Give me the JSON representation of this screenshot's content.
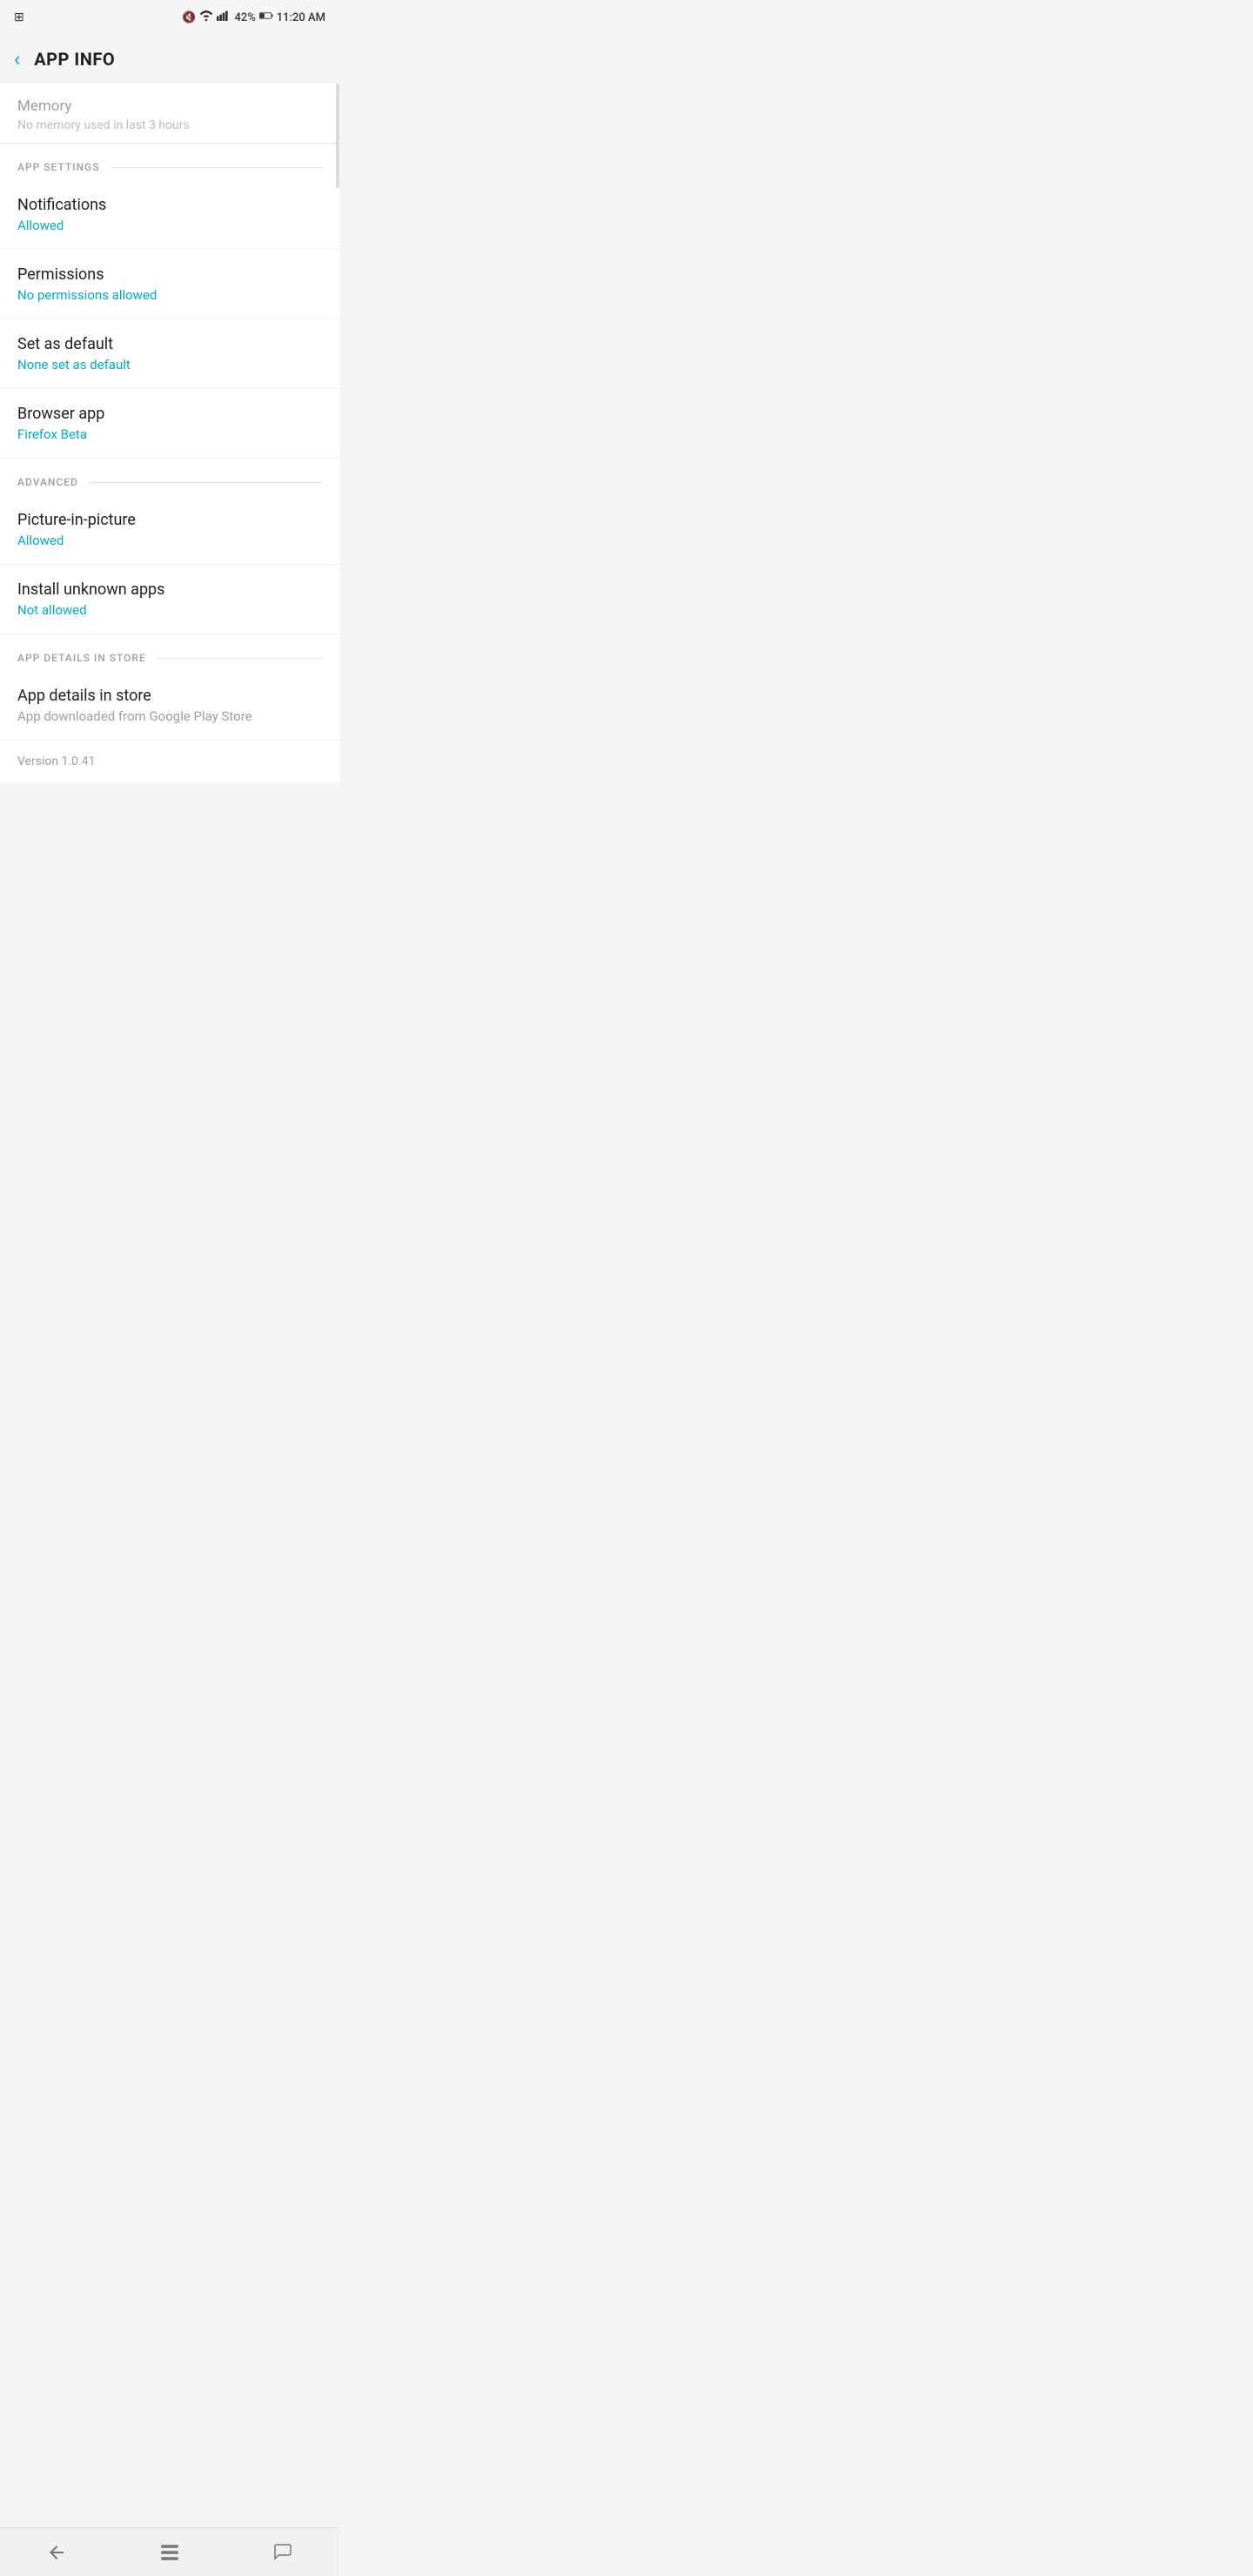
{
  "statusBar": {
    "time": "11:20 AM",
    "battery": "42%",
    "signalBars": "▋▋▋▋",
    "wifiIcon": "wifi",
    "muteIcon": "mute"
  },
  "header": {
    "backLabel": "‹",
    "title": "APP INFO"
  },
  "memory": {
    "title": "Memory",
    "subtitle": "No memory used in last 3 hours"
  },
  "sections": {
    "appSettings": {
      "label": "APP SETTINGS"
    },
    "advanced": {
      "label": "ADVANCED"
    },
    "appDetailsInStore": {
      "label": "APP DETAILS IN STORE"
    }
  },
  "items": {
    "notifications": {
      "title": "Notifications",
      "subtitle": "Allowed"
    },
    "permissions": {
      "title": "Permissions",
      "subtitle": "No permissions allowed"
    },
    "setAsDefault": {
      "title": "Set as default",
      "subtitle": "None set as default"
    },
    "browserApp": {
      "title": "Browser app",
      "subtitle": "Firefox Beta"
    },
    "pictureInPicture": {
      "title": "Picture-in-picture",
      "subtitle": "Allowed"
    },
    "installUnknownApps": {
      "title": "Install unknown apps",
      "subtitle": "Not allowed"
    },
    "appDetailsInStore": {
      "title": "App details in store",
      "subtitle": "App downloaded from Google Play Store"
    }
  },
  "version": {
    "text": "Version 1.0.41"
  },
  "colors": {
    "accent": "#00acc1",
    "textPrimary": "#212121",
    "textSecondary": "#9e9e9e",
    "divider": "#e0e0e0"
  }
}
